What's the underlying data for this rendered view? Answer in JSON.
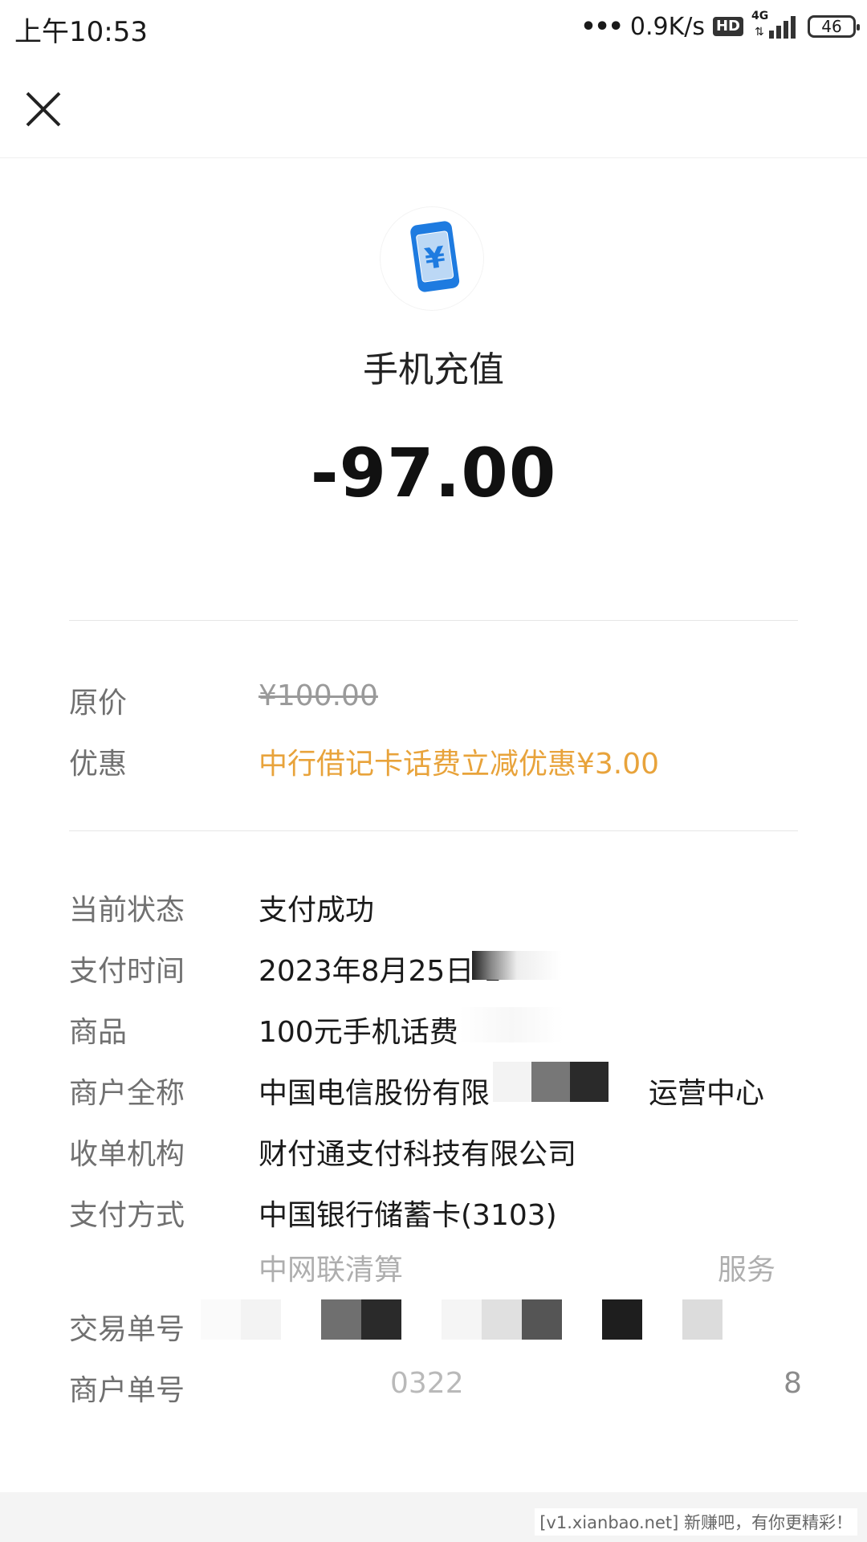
{
  "status_bar": {
    "time": "上午10:53",
    "net_speed": "0.9K/s",
    "hd": "HD",
    "network": "4G",
    "battery": "46"
  },
  "nav": {
    "close_icon": "close-icon"
  },
  "header": {
    "logo_icon": "phone-yuan-icon",
    "title": "手机充值",
    "amount": "-97.00"
  },
  "price": {
    "original_label": "原价",
    "original_value": "¥100.00",
    "discount_label": "优惠",
    "discount_value": "中行借记卡话费立减优惠¥3.00"
  },
  "details": {
    "status_label": "当前状态",
    "status_value": "支付成功",
    "time_label": "支付时间",
    "time_value": "2023年8月25日 1",
    "goods_label": "商品",
    "goods_value": "100元手机话费",
    "merchant_label": "商户全称",
    "merchant_value_a": "中国电信股份有限",
    "merchant_value_b": "运营中心",
    "acquirer_label": "收单机构",
    "acquirer_value": "财付通支付科技有限公司",
    "payment_label": "支付方式",
    "payment_value": "中国银行储蓄卡(3103)",
    "payment_sub_a": "中网联清算",
    "payment_sub_b": "服务",
    "trade_no_label": "交易单号",
    "merchant_no_label": "商户单号",
    "merchant_no_a": "0322",
    "merchant_no_b": "8"
  },
  "colors": {
    "discount": "#E8A33B",
    "logo_blue": "#1E7BE0"
  },
  "watermark": "[v1.xianbao.net] 新赚吧，有你更精彩！"
}
